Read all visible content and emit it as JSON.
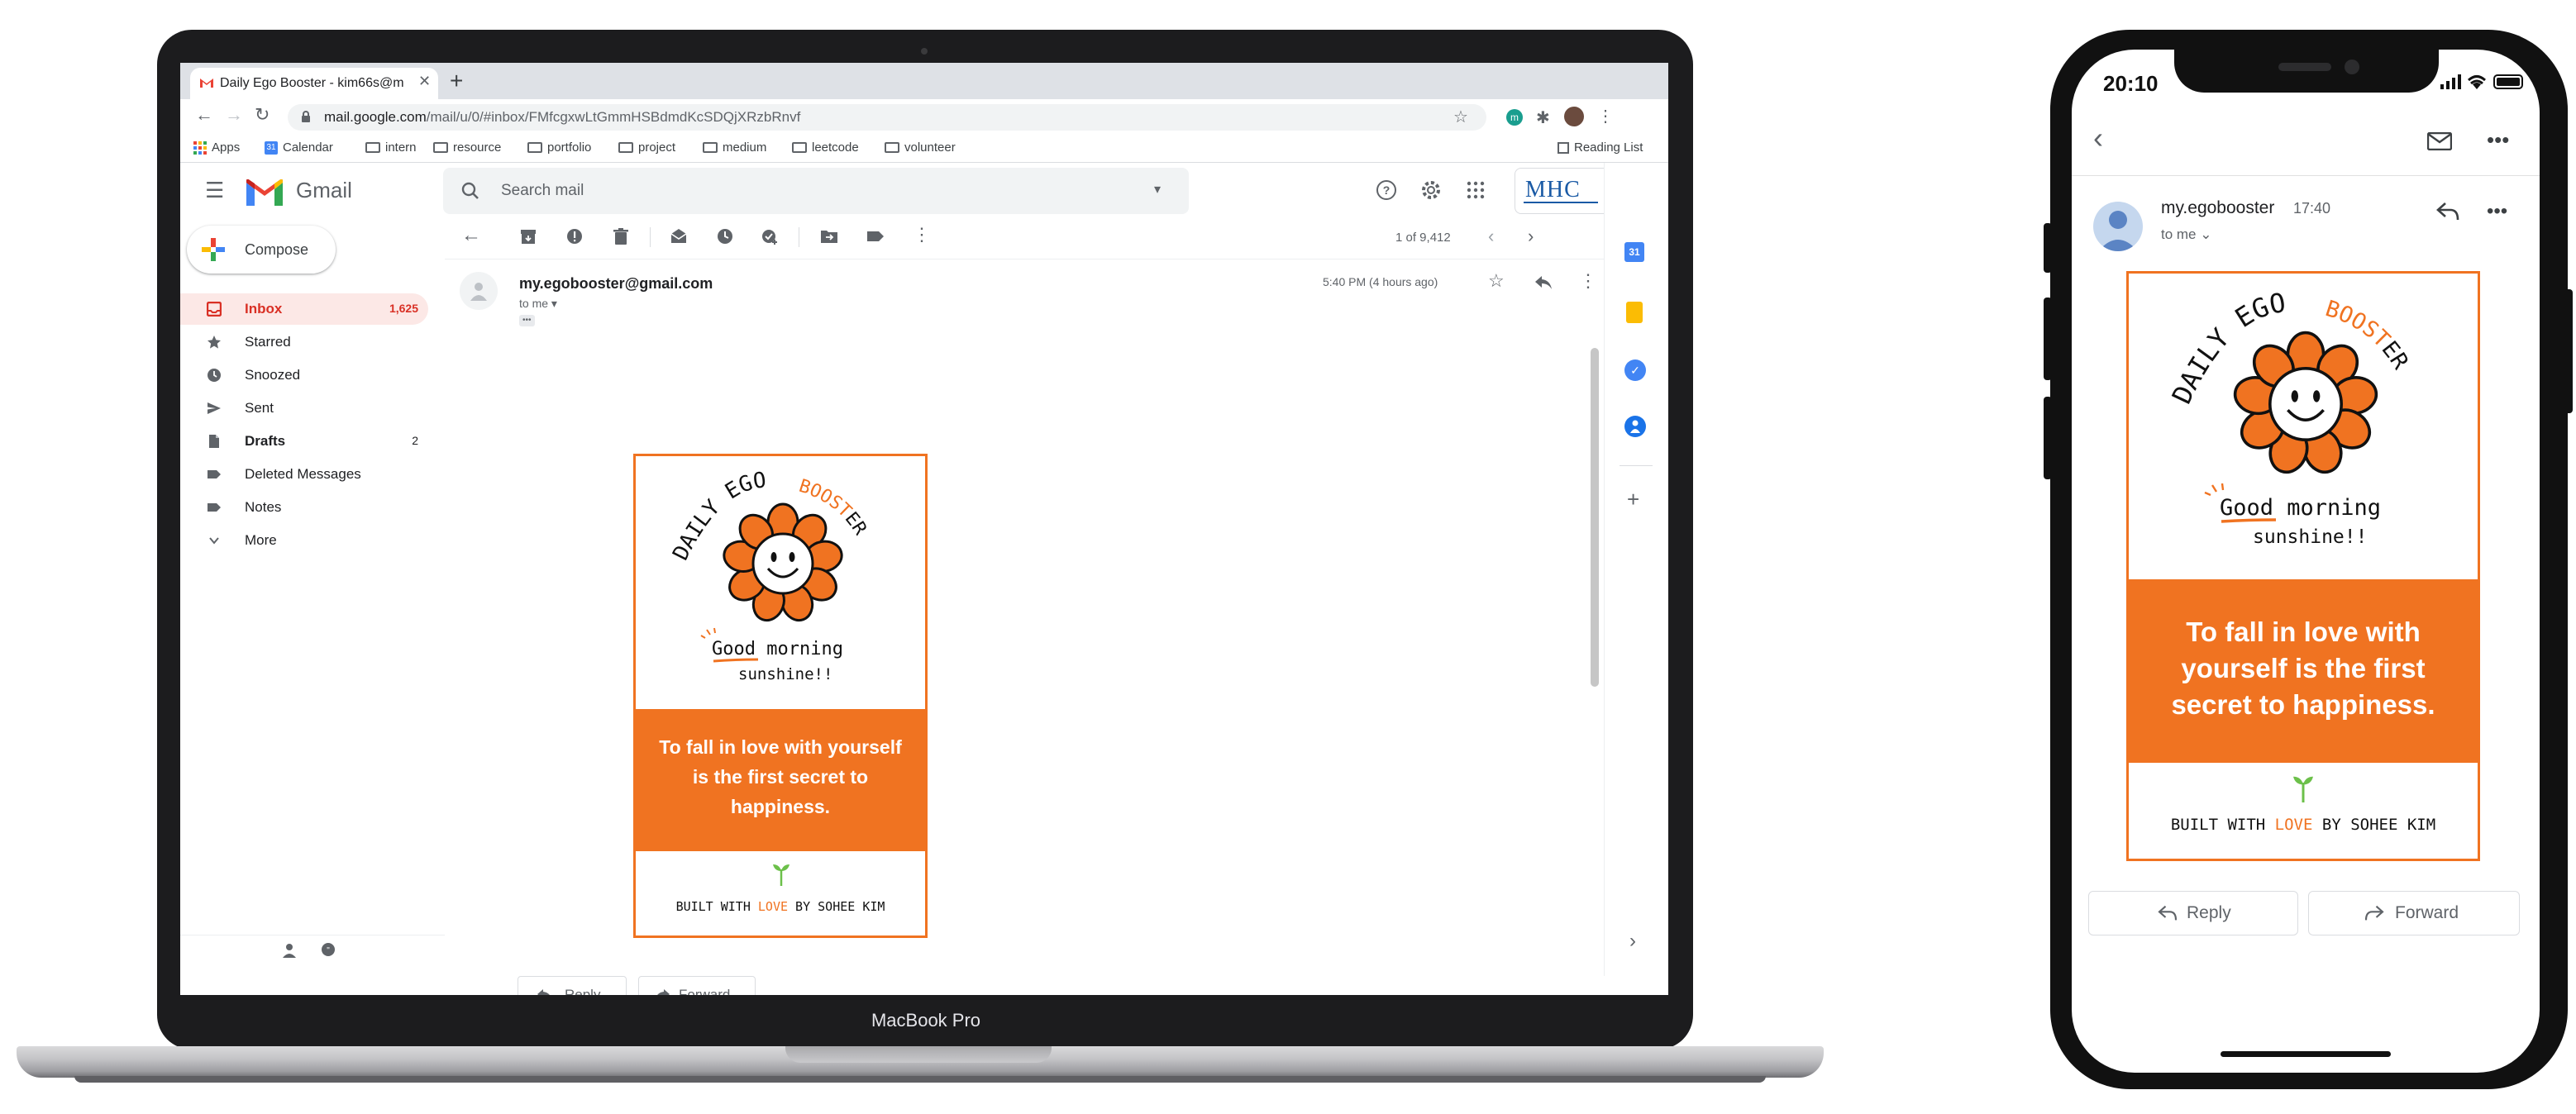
{
  "laptop": {
    "brand": "MacBook Pro",
    "browser": {
      "tab_title": "Daily Ego Booster - kim66s@m",
      "url_domain": "mail.google.com",
      "url_path": "/mail/u/0/#inbox/FMfcgxwLtGmmHSBdmdKcSDQjXRzbRnvf",
      "bookmarks": [
        "Apps",
        "Calendar",
        "intern",
        "resource",
        "portfolio",
        "project",
        "medium",
        "leetcode",
        "volunteer"
      ],
      "reading_list": "Reading List"
    },
    "gmail": {
      "logo_text": "Gmail",
      "search_placeholder": "Search mail",
      "account_logo": "MHC",
      "compose_label": "Compose",
      "nav": [
        {
          "label": "Inbox",
          "count": "1,625",
          "icon": "inbox-icon"
        },
        {
          "label": "Starred",
          "count": "",
          "icon": "star-icon"
        },
        {
          "label": "Snoozed",
          "count": "",
          "icon": "clock-icon"
        },
        {
          "label": "Sent",
          "count": "",
          "icon": "send-icon"
        },
        {
          "label": "Drafts",
          "count": "2",
          "icon": "draft-icon"
        },
        {
          "label": "Deleted Messages",
          "count": "",
          "icon": "label-icon"
        },
        {
          "label": "Notes",
          "count": "",
          "icon": "label-icon"
        },
        {
          "label": "More",
          "count": "",
          "icon": "chevron-down-icon"
        }
      ],
      "pager_text": "1 of 9,412",
      "message": {
        "sender": "my.egobooster@gmail.com",
        "to": "to me",
        "time": "5:40 PM (4 hours ago)",
        "ellipsis": "•••"
      },
      "reply_label": "Reply",
      "forward_label": "Forward"
    }
  },
  "email_content": {
    "brand_daily": "DAILY",
    "brand_ego": "EGO",
    "brand_booster_orange": "BOOST",
    "brand_booster_black": "ER",
    "greeting_1": "Good morning",
    "greeting_2": "sunshine!!",
    "quote": "To fall in love with yourself is the first secret to happiness.",
    "footer_prefix": "BUILT WITH ",
    "footer_love": "LOVE",
    "footer_suffix": " BY SOHEE KIM",
    "colors": {
      "orange": "#f07321",
      "sprout": "#6cc04a"
    }
  },
  "phone": {
    "time": "20:10",
    "sender": "my.egobooster",
    "msg_time": "17:40",
    "to": "to me",
    "reply_label": "Reply",
    "forward_label": "Forward"
  }
}
